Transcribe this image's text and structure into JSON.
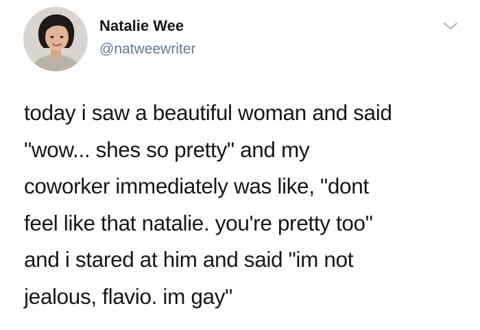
{
  "author": {
    "display_name": "Natalie Wee",
    "handle": "@natweewriter",
    "avatar_icon": "profile-photo"
  },
  "menu": {
    "icon": "chevron-down-icon"
  },
  "tweet": {
    "lines": [
      "today i saw a beautiful woman and said",
      "\"wow... shes so pretty\" and my",
      "coworker immediately was like, \"dont",
      "feel like that natalie. you're pretty too\"",
      "and i stared at him and said \"im not",
      "jealous, flavio. im gay\""
    ]
  },
  "colors": {
    "text": "#14171a",
    "secondary": "#657786",
    "caret": "#aab8c2"
  }
}
